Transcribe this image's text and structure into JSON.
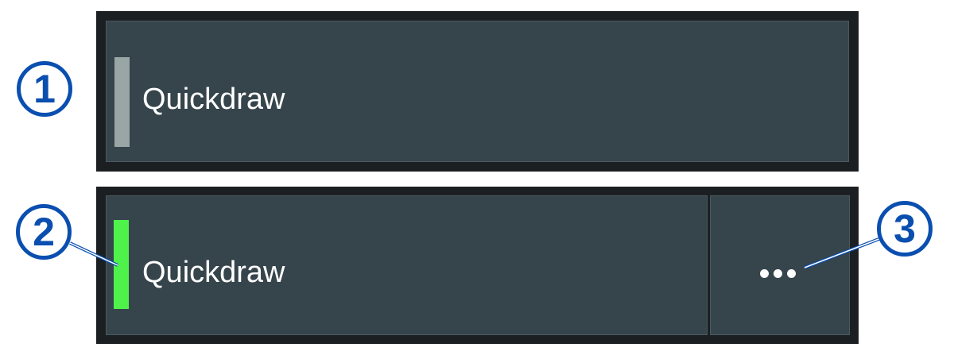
{
  "panels": [
    {
      "label": "Quickdraw",
      "indicator_color": "#9aa5a6",
      "indicator_state": "inactive"
    },
    {
      "label": "Quickdraw",
      "indicator_color": "#4ef24b",
      "indicator_state": "active",
      "more_button_icon": "ellipsis-icon"
    }
  ],
  "callouts": [
    "1",
    "2",
    "3"
  ],
  "colors": {
    "tile_background": "#36444b",
    "frame": "#1c1f21",
    "callout": "#0a4fb0"
  }
}
